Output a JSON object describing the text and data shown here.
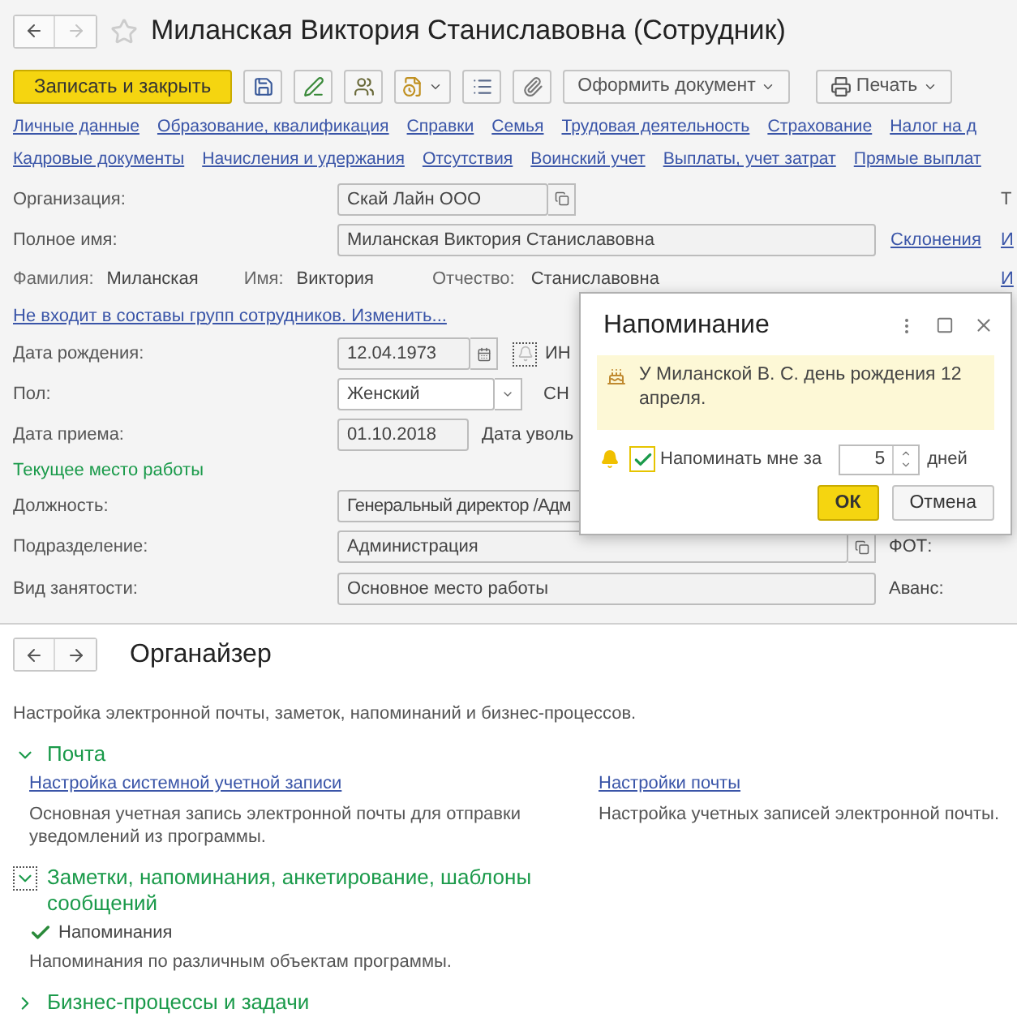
{
  "window": {
    "title": "Миланская Виктория Станиславовна (Сотрудник)",
    "nav": [
      {
        "kind": "back",
        "disabled": false
      },
      {
        "kind": "forward",
        "disabled": true
      }
    ]
  },
  "toolbar": {
    "primary": "Записать и закрыть",
    "tools": [
      {
        "kind": "save",
        "dropdown": false
      },
      {
        "kind": "edit",
        "dropdown": false
      },
      {
        "kind": "users",
        "dropdown": false
      },
      {
        "kind": "report",
        "dropdown": true
      },
      {
        "kind": "list",
        "dropdown": false
      },
      {
        "kind": "attach",
        "dropdown": false
      }
    ],
    "menus": [
      {
        "label": "Оформить документ",
        "kind": "plain"
      },
      {
        "label": "Печать",
        "kind": "print"
      }
    ]
  },
  "links": [
    [
      "Личные данные",
      "Образование, квалификация",
      "Справки",
      "Семья",
      "Трудовая деятельность",
      "Страхование",
      "Налог на д"
    ],
    [
      "Кадровые документы",
      "Начисления и удержания",
      "Отсутствия",
      "Воинский учет",
      "Выплаты, учет затрат",
      "Прямые выплат"
    ]
  ],
  "form": {
    "organization": {
      "label": "Организация:",
      "value": "Скай Лайн ООО",
      "edge_label": "Т"
    },
    "full_name": {
      "label": "Полное имя:",
      "value": "Миланская Виктория Станиславовна",
      "link": "Склонения",
      "edge_link": "И"
    },
    "name_parts": [
      {
        "label": "Фамилия:",
        "value": "Миланская"
      },
      {
        "label": "Имя:",
        "value": "Виктория"
      },
      {
        "label": "Отчество:",
        "value": "Станиславовна"
      }
    ],
    "name_edge_link": "И",
    "groups_link": "Не входит в составы групп сотрудников. Изменить...",
    "birth_date": {
      "label": "Дата рождения:",
      "value": "12.04.1973",
      "side_label": "ИН"
    },
    "gender": {
      "label": "Пол:",
      "value": "Женский",
      "side_label": "СН"
    },
    "hire_date": {
      "label": "Дата приема:",
      "value": "01.10.2018",
      "side_label": "Дата уволь"
    },
    "section": "Текущее место работы",
    "position": {
      "label": "Должность:",
      "value": "Генеральный директор /Адм"
    },
    "department": {
      "label": "Подразделение:",
      "value": "Администрация",
      "side_label": "ФОТ:"
    },
    "employment": {
      "label": "Вид занятости:",
      "value": "Основное место работы",
      "side_label": "Аванс:"
    }
  },
  "reminder_dialog": {
    "title": "Напоминание",
    "message": "У Миланской В. С. день рождения 12 апреля.",
    "remind": {
      "checked": true,
      "label": "Напоминать мне за",
      "value": "5",
      "unit": "дней"
    },
    "buttons": [
      {
        "label": "ОК",
        "kind": "primary"
      },
      {
        "label": "Отмена",
        "kind": "secondary"
      }
    ]
  },
  "organizer": {
    "nav": [
      {
        "kind": "back",
        "disabled": false
      },
      {
        "kind": "forward",
        "disabled": false
      }
    ],
    "title": "Органайзер",
    "description": "Настройка электронной почты, заметок, напоминаний и бизнес-процессов.",
    "sections": [
      {
        "title": "Почта",
        "expanded": true,
        "focused": false,
        "links": [
          {
            "label": "Настройка системной учетной записи",
            "description": "Основная учетная запись электронной почты для отправки уведомлений из программы."
          },
          {
            "label": "Настройки почты",
            "description": "Настройка учетных записей электронной почты."
          }
        ]
      },
      {
        "title": "Заметки, напоминания, анкетирование, шаблоны сообщений",
        "expanded": true,
        "focused": true,
        "options": [
          {
            "label": "Напоминания",
            "checked": true,
            "description": "Напоминания по различным объектам программы."
          }
        ]
      },
      {
        "title": "Бизнес-процессы и задачи",
        "expanded": false,
        "focused": false
      }
    ]
  }
}
